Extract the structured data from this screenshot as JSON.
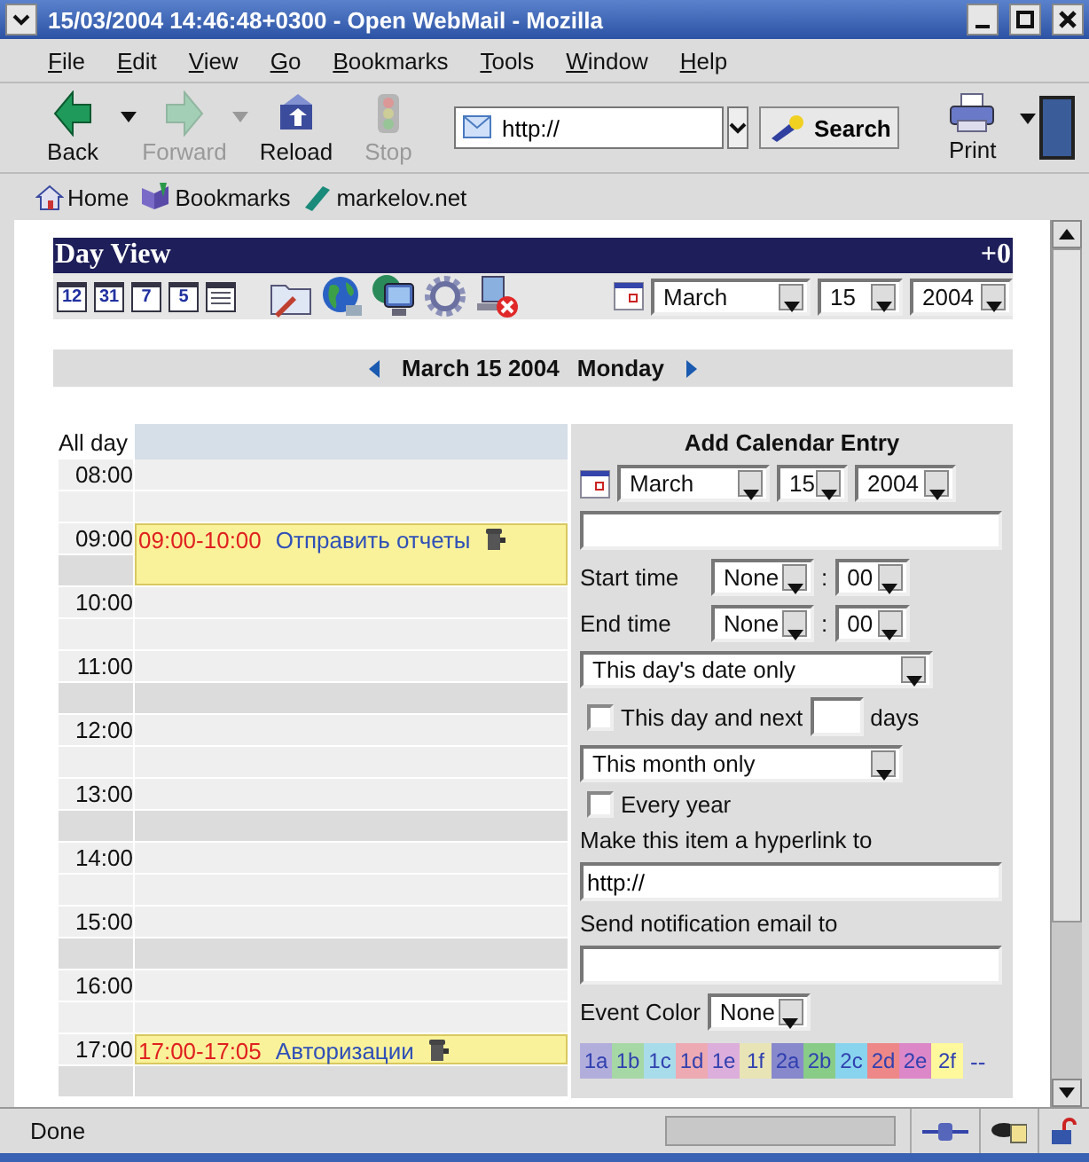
{
  "window": {
    "title": "15/03/2004 14:46:48+0300 - Open WebMail - Mozilla"
  },
  "menu": [
    "File",
    "Edit",
    "View",
    "Go",
    "Bookmarks",
    "Tools",
    "Window",
    "Help"
  ],
  "navigation_toolbar": {
    "buttons": [
      {
        "kind": "back",
        "label": "Back",
        "disabled": false,
        "dropdown": true
      },
      {
        "kind": "forward",
        "label": "Forward",
        "disabled": true,
        "dropdown": true
      },
      {
        "kind": "reload",
        "label": "Reload",
        "disabled": false,
        "dropdown": false
      },
      {
        "kind": "stop",
        "label": "Stop",
        "disabled": true,
        "dropdown": false
      }
    ],
    "url_field": {
      "value": "http://"
    },
    "search_button": "Search",
    "print_button": {
      "label": "Print",
      "dropdown": true
    }
  },
  "personal_toolbar": [
    {
      "kind": "home",
      "label": "Home"
    },
    {
      "kind": "bookmarks",
      "label": "Bookmarks"
    },
    {
      "kind": "link",
      "label": "markelov.net"
    }
  ],
  "day_view": {
    "title": "Day View",
    "timezone": "+0",
    "view_buttons": [
      {
        "kind": "calendar",
        "label": "12"
      },
      {
        "kind": "calendar",
        "label": "31"
      },
      {
        "kind": "calendar",
        "label": "7"
      },
      {
        "kind": "calendar",
        "label": "5"
      },
      {
        "kind": "list"
      }
    ],
    "tool_icons": [
      {
        "kind": "compose"
      },
      {
        "kind": "globe"
      },
      {
        "kind": "terminal"
      },
      {
        "kind": "gear"
      },
      {
        "kind": "logout"
      }
    ],
    "date_selects": {
      "month": "March",
      "day": "15",
      "year": "2004"
    },
    "date_nav": {
      "date": "March 15 2004",
      "weekday": "Monday"
    }
  },
  "calendar": {
    "all_day_label": "All day",
    "hours": [
      {
        "time": "08:00"
      },
      {
        "time": "09:00",
        "event": {
          "kind": "hour",
          "time_range": "09:00-10:00",
          "title": "Отправить отчеты"
        }
      },
      {
        "time": "10:00"
      },
      {
        "time": "11:00"
      },
      {
        "time": "12:00"
      },
      {
        "time": "13:00"
      },
      {
        "time": "14:00"
      },
      {
        "time": "15:00"
      },
      {
        "time": "16:00"
      },
      {
        "time": "17:00",
        "event": {
          "kind": "half",
          "time_range": "17:00-17:05",
          "title": "Авторизации"
        }
      }
    ]
  },
  "add_entry": {
    "title": "Add Calendar Entry",
    "month": "March",
    "day": "15",
    "year": "2004",
    "start_time_label": "Start time",
    "start_hour": "None",
    "start_minute": "00",
    "end_time_label": "End time",
    "end_hour": "None",
    "end_minute": "00",
    "time_separator": ":",
    "recurrence": "This day's date only",
    "next_days": {
      "label": "This day and next",
      "checked": false,
      "unit": "days"
    },
    "month_scope": "This month only",
    "every_year": {
      "label": "Every year",
      "checked": false
    },
    "hyperlink_label": "Make this item a hyperlink to",
    "hyperlink_value": "http://",
    "email_label": "Send notification email to",
    "event_color_label": "Event Color",
    "event_color": "None",
    "colors": [
      {
        "label": "1a",
        "color": "#b2aedc"
      },
      {
        "label": "1b",
        "color": "#a6d8a6"
      },
      {
        "label": "1c",
        "color": "#a8dcea"
      },
      {
        "label": "1d",
        "color": "#eeaab2"
      },
      {
        "label": "1e",
        "color": "#dcaedc"
      },
      {
        "label": "1f",
        "color": "#e8e4b6"
      },
      {
        "label": "2a",
        "color": "#8888cc"
      },
      {
        "label": "2b",
        "color": "#88cc88"
      },
      {
        "label": "2c",
        "color": "#88d4ee"
      },
      {
        "label": "2d",
        "color": "#ee8888"
      },
      {
        "label": "2e",
        "color": "#dc88c8"
      },
      {
        "label": "2f",
        "color": "#fff89c"
      }
    ],
    "no_color": "--"
  },
  "status_bar": {
    "text": "Done",
    "progress": {
      "level": 0
    }
  }
}
